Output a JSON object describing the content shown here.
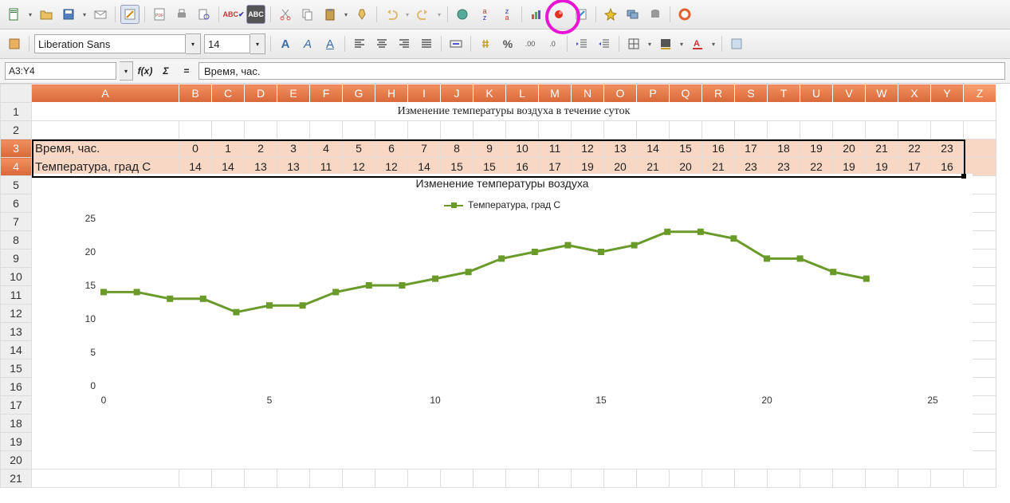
{
  "font_name": "Liberation Sans",
  "font_size": "14",
  "cell_ref": "A3:Y4",
  "formula": "Время, час.",
  "cols": [
    "A",
    "B",
    "C",
    "D",
    "E",
    "F",
    "G",
    "H",
    "I",
    "J",
    "K",
    "L",
    "M",
    "N",
    "O",
    "P",
    "Q",
    "R",
    "S",
    "T",
    "U",
    "V",
    "W",
    "X",
    "Y",
    "Z"
  ],
  "rows": [
    "1",
    "2",
    "3",
    "4",
    "5",
    "6",
    "7",
    "8",
    "9",
    "10",
    "11",
    "12",
    "13",
    "14",
    "15",
    "16",
    "17",
    "18",
    "19",
    "20",
    "21"
  ],
  "title": "Изменение температуры воздуха в течение суток",
  "row3_label": "Время, час.",
  "row4_label": "Температура, град С",
  "hours": [
    "0",
    "1",
    "2",
    "3",
    "4",
    "5",
    "6",
    "7",
    "8",
    "9",
    "10",
    "11",
    "12",
    "13",
    "14",
    "15",
    "16",
    "17",
    "18",
    "19",
    "20",
    "21",
    "22",
    "23"
  ],
  "temps": [
    "14",
    "14",
    "13",
    "13",
    "11",
    "12",
    "12",
    "14",
    "15",
    "15",
    "16",
    "17",
    "19",
    "20",
    "21",
    "20",
    "21",
    "23",
    "23",
    "22",
    "19",
    "19",
    "17",
    "16"
  ],
  "chart_title": "Изменение температуры воздуха",
  "legend": "Температура, град С",
  "chart_data": {
    "type": "line",
    "title": "Изменение температуры воздуха",
    "xlabel": "",
    "ylabel": "",
    "xlim": [
      0,
      25
    ],
    "ylim": [
      0,
      25
    ],
    "xticks": [
      0,
      5,
      10,
      15,
      20,
      25
    ],
    "yticks": [
      0,
      5,
      10,
      15,
      20,
      25
    ],
    "series": [
      {
        "name": "Температура, град С",
        "x": [
          0,
          1,
          2,
          3,
          4,
          5,
          6,
          7,
          8,
          9,
          10,
          11,
          12,
          13,
          14,
          15,
          16,
          17,
          18,
          19,
          20,
          21,
          22,
          23
        ],
        "y": [
          14,
          14,
          13,
          13,
          11,
          12,
          12,
          14,
          15,
          15,
          16,
          17,
          19,
          20,
          21,
          20,
          21,
          23,
          23,
          22,
          19,
          19,
          17,
          16
        ]
      }
    ]
  },
  "letters": {
    "B": "B",
    "I": "I",
    "U": "U",
    "a": "a",
    "z": "z",
    "fx": "f(x)",
    "sigma": "Σ",
    "eq": "=",
    "pct": "%"
  }
}
